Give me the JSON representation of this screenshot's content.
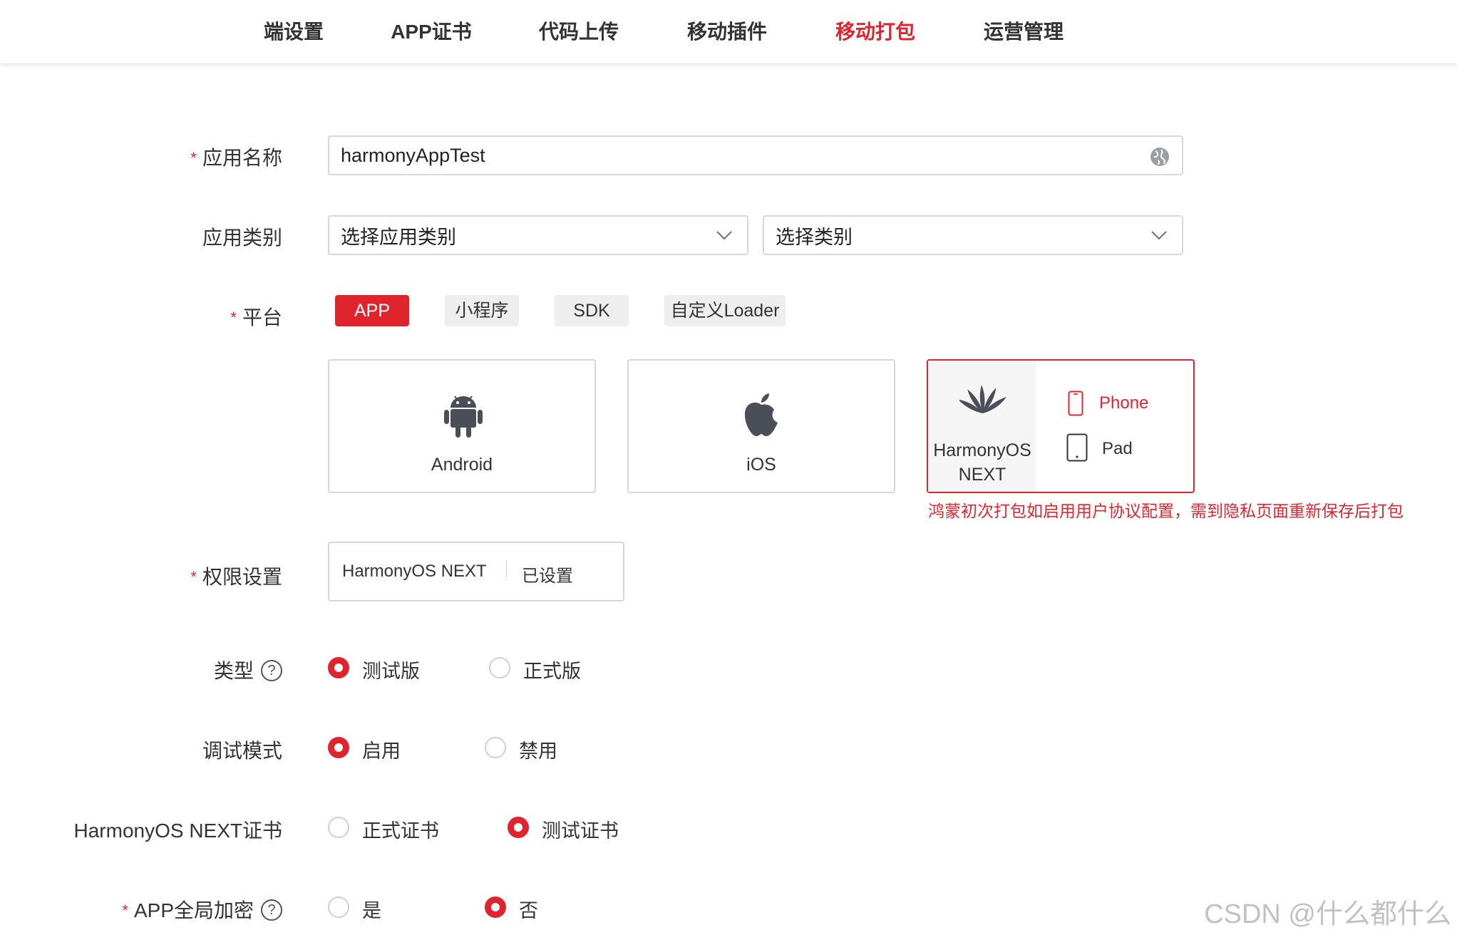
{
  "nav": {
    "tabs": [
      {
        "label": "端设置"
      },
      {
        "label": "APP证书"
      },
      {
        "label": "代码上传"
      },
      {
        "label": "移动插件"
      },
      {
        "label": "移动打包"
      },
      {
        "label": "运营管理"
      }
    ],
    "active_tab": "移动打包",
    "accent_color": "#e0242e"
  },
  "form": {
    "app_name": {
      "label": "应用名称",
      "required": true,
      "value": "harmonyAppTest",
      "icon": "globe-icon"
    },
    "app_category": {
      "label": "应用类别",
      "select1_value": "选择应用类别",
      "select2_value": "选择类别"
    },
    "platform": {
      "label": "平台",
      "required": true,
      "tabs": [
        {
          "label": "APP",
          "selected": true
        },
        {
          "label": "小程序",
          "selected": false
        },
        {
          "label": "SDK",
          "selected": false
        },
        {
          "label": "自定义Loader",
          "selected": false
        }
      ],
      "targets": {
        "android": {
          "label": "Android",
          "icon": "android-icon"
        },
        "ios": {
          "label": "iOS",
          "icon": "apple-icon"
        },
        "harmony": {
          "label_line1": "HarmonyOS",
          "label_line2": "NEXT",
          "icon": "huawei-icon",
          "selected": true,
          "devices": [
            {
              "label": "Phone",
              "icon": "phone-icon",
              "selected": true
            },
            {
              "label": "Pad",
              "icon": "tablet-icon",
              "selected": false
            }
          ]
        }
      },
      "note": "鸿蒙初次打包如启用用户协议配置，需到隐私页面重新保存后打包"
    },
    "permission": {
      "label": "权限设置",
      "required": true,
      "platform": "HarmonyOS NEXT",
      "status": "已设置"
    },
    "build_type": {
      "label": "类型",
      "help": "?",
      "options": [
        {
          "label": "测试版",
          "checked": true
        },
        {
          "label": "正式版",
          "checked": false
        }
      ]
    },
    "debug_mode": {
      "label": "调试模式",
      "options": [
        {
          "label": "启用",
          "checked": true
        },
        {
          "label": "禁用",
          "checked": false
        }
      ]
    },
    "harmony_cert": {
      "label": "HarmonyOS NEXT证书",
      "options": [
        {
          "label": "正式证书",
          "checked": false
        },
        {
          "label": "测试证书",
          "checked": true
        }
      ]
    },
    "encryption": {
      "label": "APP全局加密",
      "required": true,
      "help": "?",
      "options": [
        {
          "label": "是",
          "checked": false
        },
        {
          "label": "否",
          "checked": true
        }
      ]
    }
  },
  "watermark": "CSDN @什么都什么"
}
